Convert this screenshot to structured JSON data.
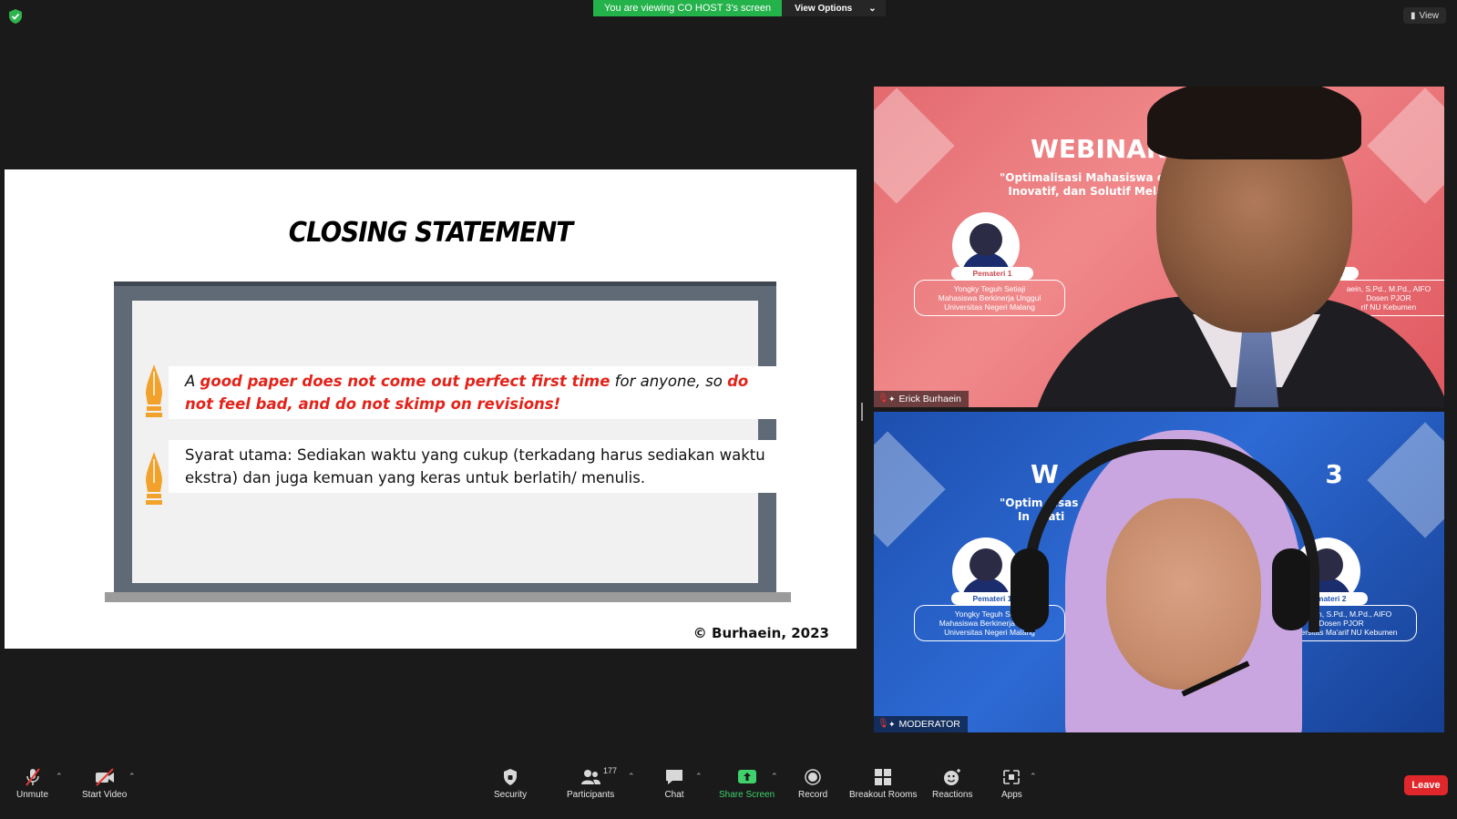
{
  "banner": {
    "viewing_text": "You are viewing CO HOST 3's screen",
    "view_options": "View Options",
    "view_button": "View"
  },
  "slide": {
    "title": "CLOSING STATEMENT",
    "bullet1": {
      "a": "A ",
      "b": "good paper does not come out perfect first time",
      "c": " for anyone, so ",
      "d": "do not feel bad, and do not skimp on revisions!"
    },
    "bullet2": "Syarat utama: Sediakan waktu yang cukup (terkadang harus sediakan waktu ekstra) dan juga kemuan yang keras untuk berlatih/ menulis.",
    "copyright": "© Burhaein, 2023"
  },
  "tiles": [
    {
      "participant": "Erick Burhaein",
      "bg_title": "WEBINAR",
      "bg_sub": "\"Optimalisasi Mahasiswa da\nInovatif, dan Solutif Mela",
      "speaker1_badge": "Pemateri 1",
      "speaker1_text": "Yongky Teguh Setiaji\nMahasiswa Berkinerja Unggul\nUniversitas Negeri Malang",
      "speaker2_badge": "ateri 2",
      "speaker2_text": "aein, S.Pd., M.Pd., AIFO\nDosen PJOR\nrif NU Kebumen"
    },
    {
      "participant": "MODERATOR",
      "bg_title": "W                              3",
      "bg_sub": "\"Optim   isas                         nga   e Kreatif,\nIn   vati                            Kary   miah\"",
      "speaker1_badge": "Pemateri 1",
      "speaker1_text": "Yongky Teguh Setiaj\nMahasiswa Berkinerja Unggu\nUniversitas Negeri Malang",
      "speaker2_badge": "Pemateri 2",
      "speaker2_text": "Burhaein, S.Pd., M.Pd., AIFO\nDosen PJOR\nUniversitas Ma'arif NU Kebumen"
    }
  ],
  "toolbar": {
    "unmute": "Unmute",
    "start_video": "Start Video",
    "security": "Security",
    "participants": "Participants",
    "participants_count": "177",
    "chat": "Chat",
    "share_screen": "Share Screen",
    "record": "Record",
    "breakout_rooms": "Breakout Rooms",
    "reactions": "Reactions",
    "apps": "Apps",
    "leave": "Leave"
  },
  "colors": {
    "banner_green": "#24b24b",
    "share_green": "#3fd16b",
    "leave_red": "#e0272b",
    "slide_red": "#e3231a"
  },
  "icons": [
    "shield-icon",
    "mic-off-icon",
    "video-off-icon",
    "security-shield-icon",
    "participants-icon",
    "chat-icon",
    "share-screen-icon",
    "record-icon",
    "breakout-rooms-icon",
    "reactions-icon",
    "apps-icon",
    "pen-nib-icon",
    "pin-icon"
  ]
}
